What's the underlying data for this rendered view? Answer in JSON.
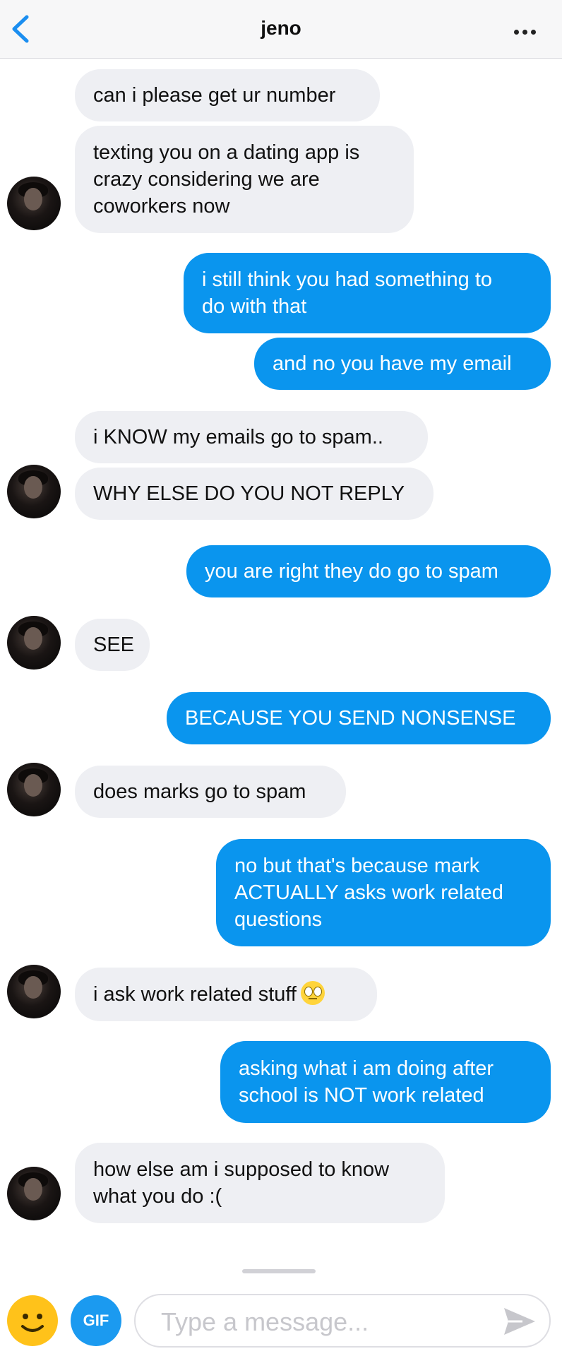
{
  "header": {
    "title": "jeno",
    "back_icon": "chevron-left-icon",
    "more_icon": "more-horizontal-icon"
  },
  "messages": [
    {
      "from": "them",
      "lines": [
        "can i please get ur number"
      ]
    },
    {
      "from": "them",
      "lines": [
        "texting you on a dating app is",
        "crazy considering we are",
        "coworkers now"
      ]
    },
    {
      "from": "me",
      "lines": [
        "i still think you had something to",
        "do with that"
      ]
    },
    {
      "from": "me",
      "lines": [
        "and no you have my email"
      ]
    },
    {
      "from": "them",
      "lines": [
        "i KNOW my emails go to spam.."
      ]
    },
    {
      "from": "them",
      "lines": [
        "WHY ELSE DO YOU NOT REPLY"
      ]
    },
    {
      "from": "me",
      "lines": [
        "you are right they do go to spam"
      ]
    },
    {
      "from": "them",
      "lines": [
        "SEE"
      ]
    },
    {
      "from": "me",
      "lines": [
        "BECAUSE YOU SEND NONSENSE"
      ]
    },
    {
      "from": "them",
      "lines": [
        "does marks go to spam"
      ]
    },
    {
      "from": "me",
      "lines": [
        "no but that's because mark",
        "ACTUALLY asks work related",
        "questions"
      ]
    },
    {
      "from": "them",
      "lines": [
        "i ask work related stuff"
      ],
      "emoji": "face-with-rolling-eyes"
    },
    {
      "from": "me",
      "lines": [
        "asking what i am doing after",
        "school is NOT work related"
      ]
    },
    {
      "from": "them",
      "lines": [
        "how else am i supposed to know",
        "what you do :("
      ]
    }
  ],
  "composer": {
    "placeholder": "Type a message...",
    "gif_label": "GIF",
    "emoji_icon": "smiley-icon",
    "send_icon": "send-icon"
  },
  "colors": {
    "incoming_bubble": "#eeeff3",
    "outgoing_bubble": "#0a95ee",
    "back_chevron": "#1b8ef0",
    "gif_button": "#1b9af0",
    "emoji_button": "#ffc21a"
  }
}
